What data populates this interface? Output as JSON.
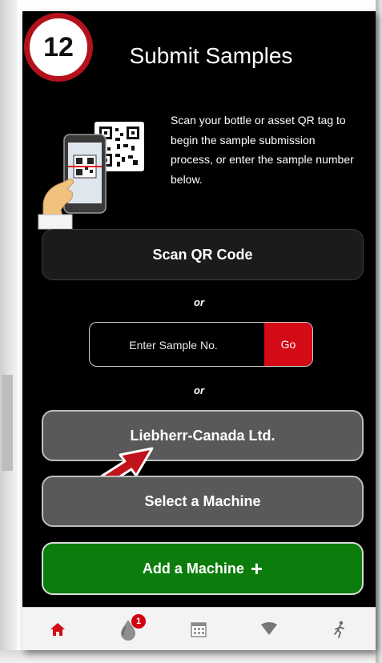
{
  "step_badge": "12",
  "title": "Submit Samples",
  "intro": "Scan your bottle or asset QR tag to begin the sample submission process, or enter the sample number below.",
  "scan_button": "Scan QR Code",
  "or_1": "or",
  "or_2": "or",
  "sample_input": {
    "placeholder": "Enter Sample No.",
    "go_label": "Go"
  },
  "company_button": "Liebherr-Canada Ltd.",
  "select_machine_button": "Select a Machine",
  "add_machine_button": "Add a Machine",
  "add_icon": "+",
  "tab_bar": {
    "tabs": [
      {
        "icon": "home-icon"
      },
      {
        "icon": "oil-drop-icon",
        "badge": "1"
      },
      {
        "icon": "calendar-icon"
      },
      {
        "icon": "signal-icon"
      },
      {
        "icon": "runner-icon"
      }
    ]
  },
  "colors": {
    "accent_red": "#d40a16",
    "badge_ring": "#b3121c",
    "add_green": "#0c7d0c",
    "background": "#000000"
  }
}
